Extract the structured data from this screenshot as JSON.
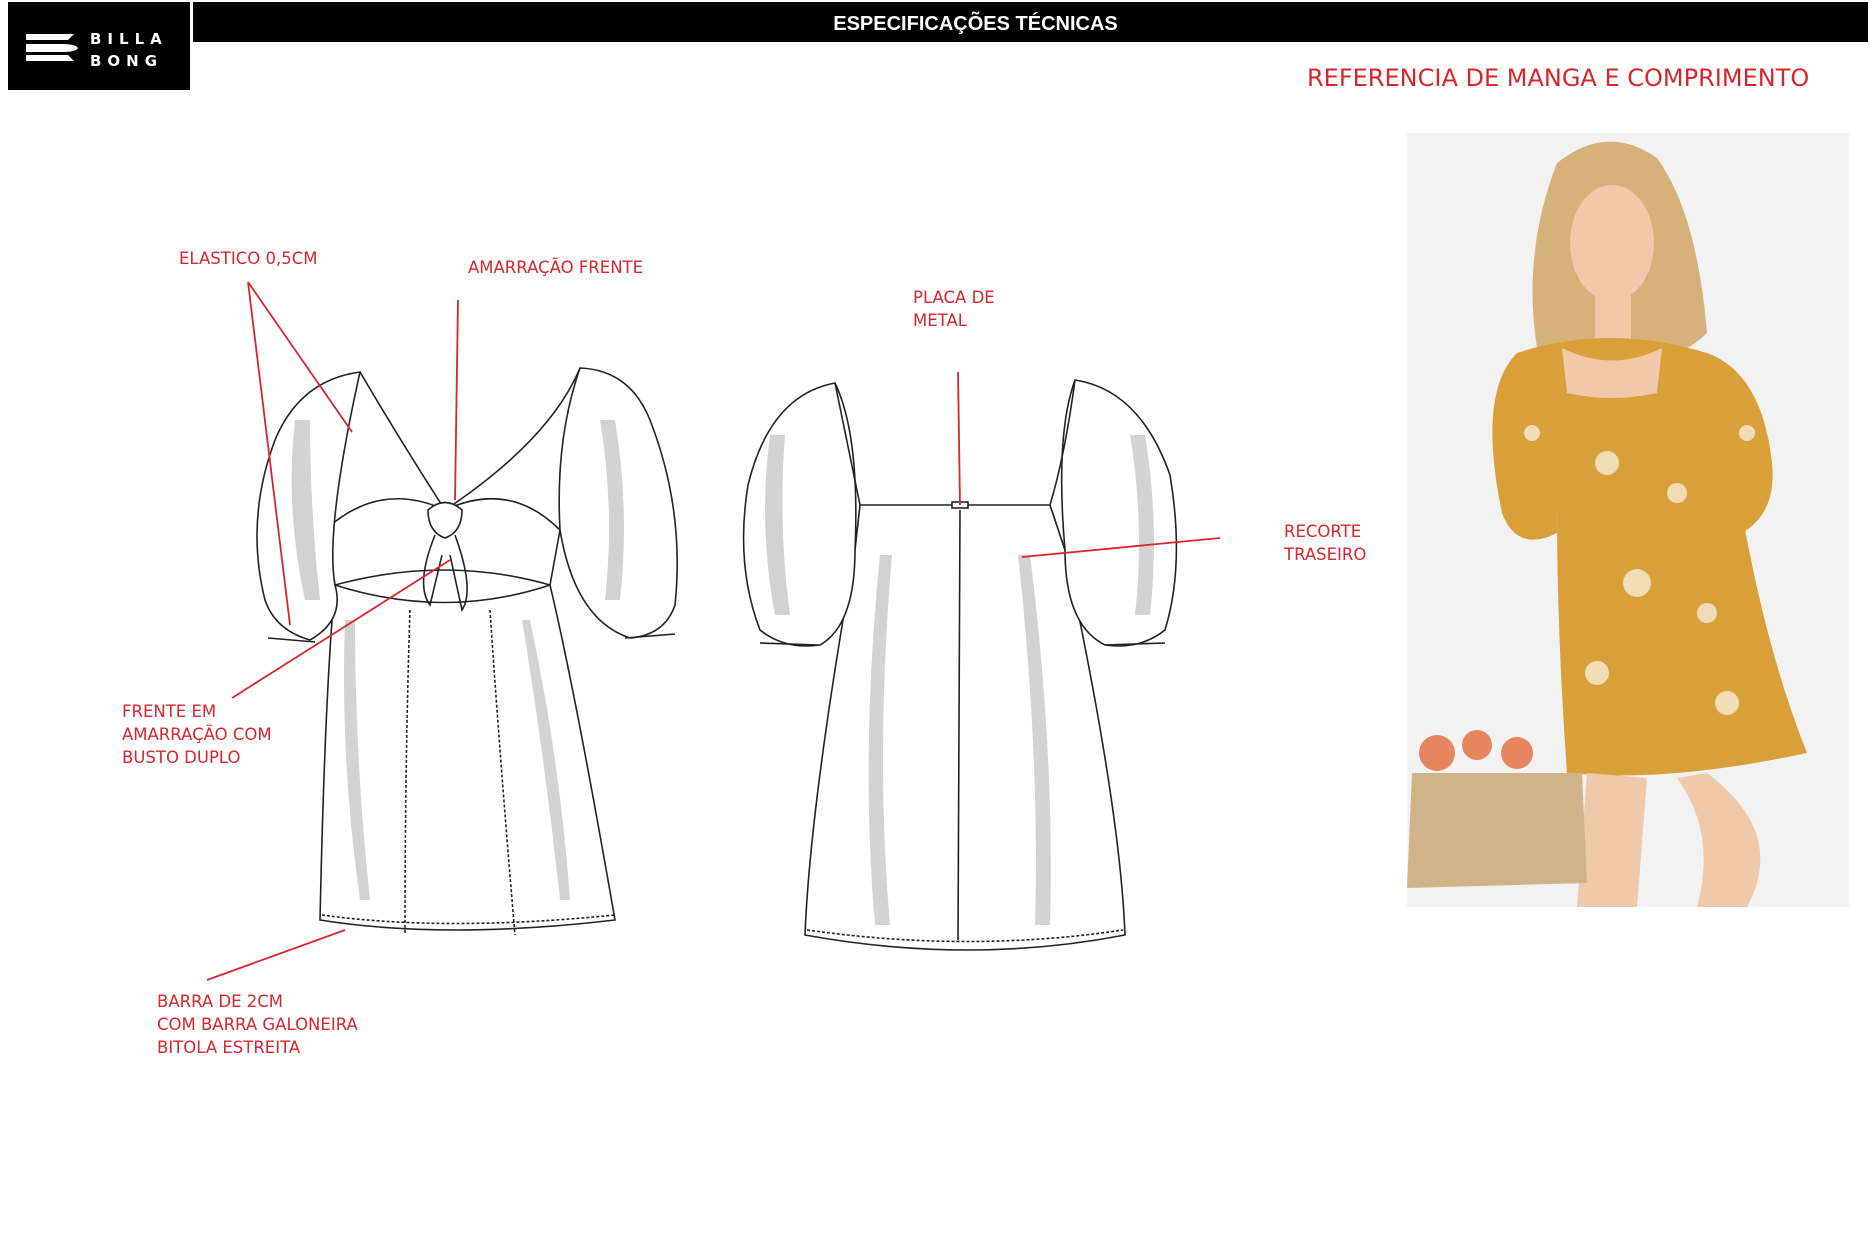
{
  "brand": {
    "line1": "BILLA",
    "line2": "BONG"
  },
  "header": {
    "title": "ESPECIFICAÇÕES TÉCNICAS"
  },
  "reference": {
    "title": "REFERENCIA DE MANGA E COMPRIMENTO"
  },
  "annotations": {
    "elastico": "ELASTICO 0,5CM",
    "amarracao_frente": "AMARRAÇÃO FRENTE",
    "placa_metal": "PLACA DE\nMETAL",
    "recorte_traseiro": "RECORTE\nTRASEIRO",
    "frente_amarracao": "FRENTE EM\nAMARRAÇÃO COM\nBUSTO DUPLO",
    "barra": "BARRA DE 2CM\nCOM BARRA GALONEIRA\nBITOLA ESTREITA"
  },
  "colors": {
    "accent": "#d7262e",
    "header_bg": "#000000",
    "dress_fabric": "#d9a03a",
    "print": "#f3e3c4"
  },
  "icons": {
    "logo": "billabong-wave-logo-icon"
  }
}
